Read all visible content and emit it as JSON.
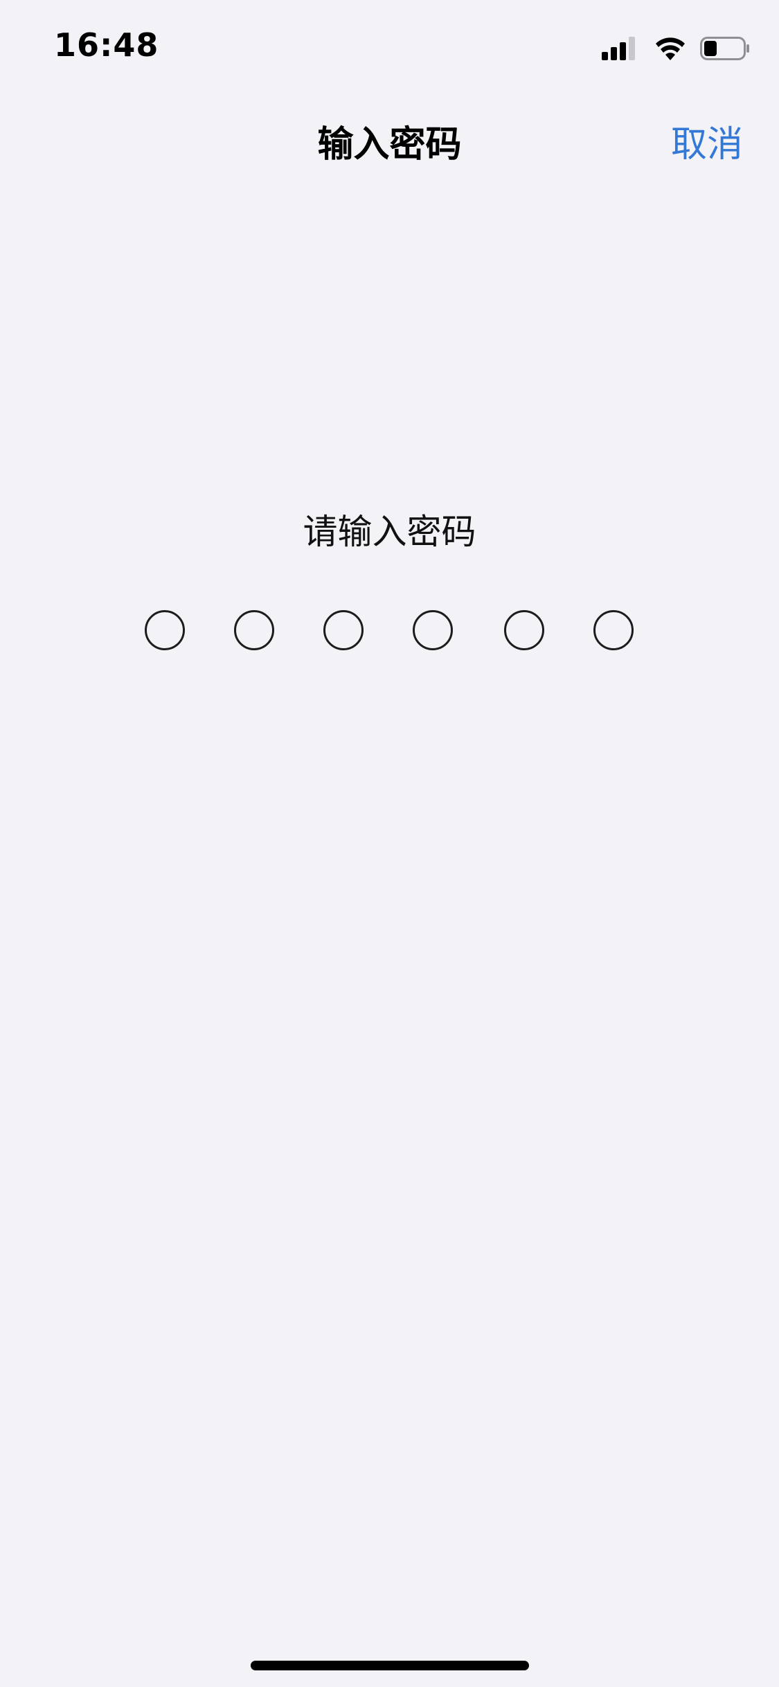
{
  "status_bar": {
    "time": "16:48",
    "icons": [
      "cellular-signal-icon",
      "wifi-icon",
      "battery-icon"
    ]
  },
  "nav": {
    "title": "输入密码",
    "cancel_label": "取消"
  },
  "passcode": {
    "prompt": "请输入密码",
    "length": 6,
    "filled": 0
  },
  "colors": {
    "accent": "#3478d6",
    "background": "#f2f2f7"
  }
}
